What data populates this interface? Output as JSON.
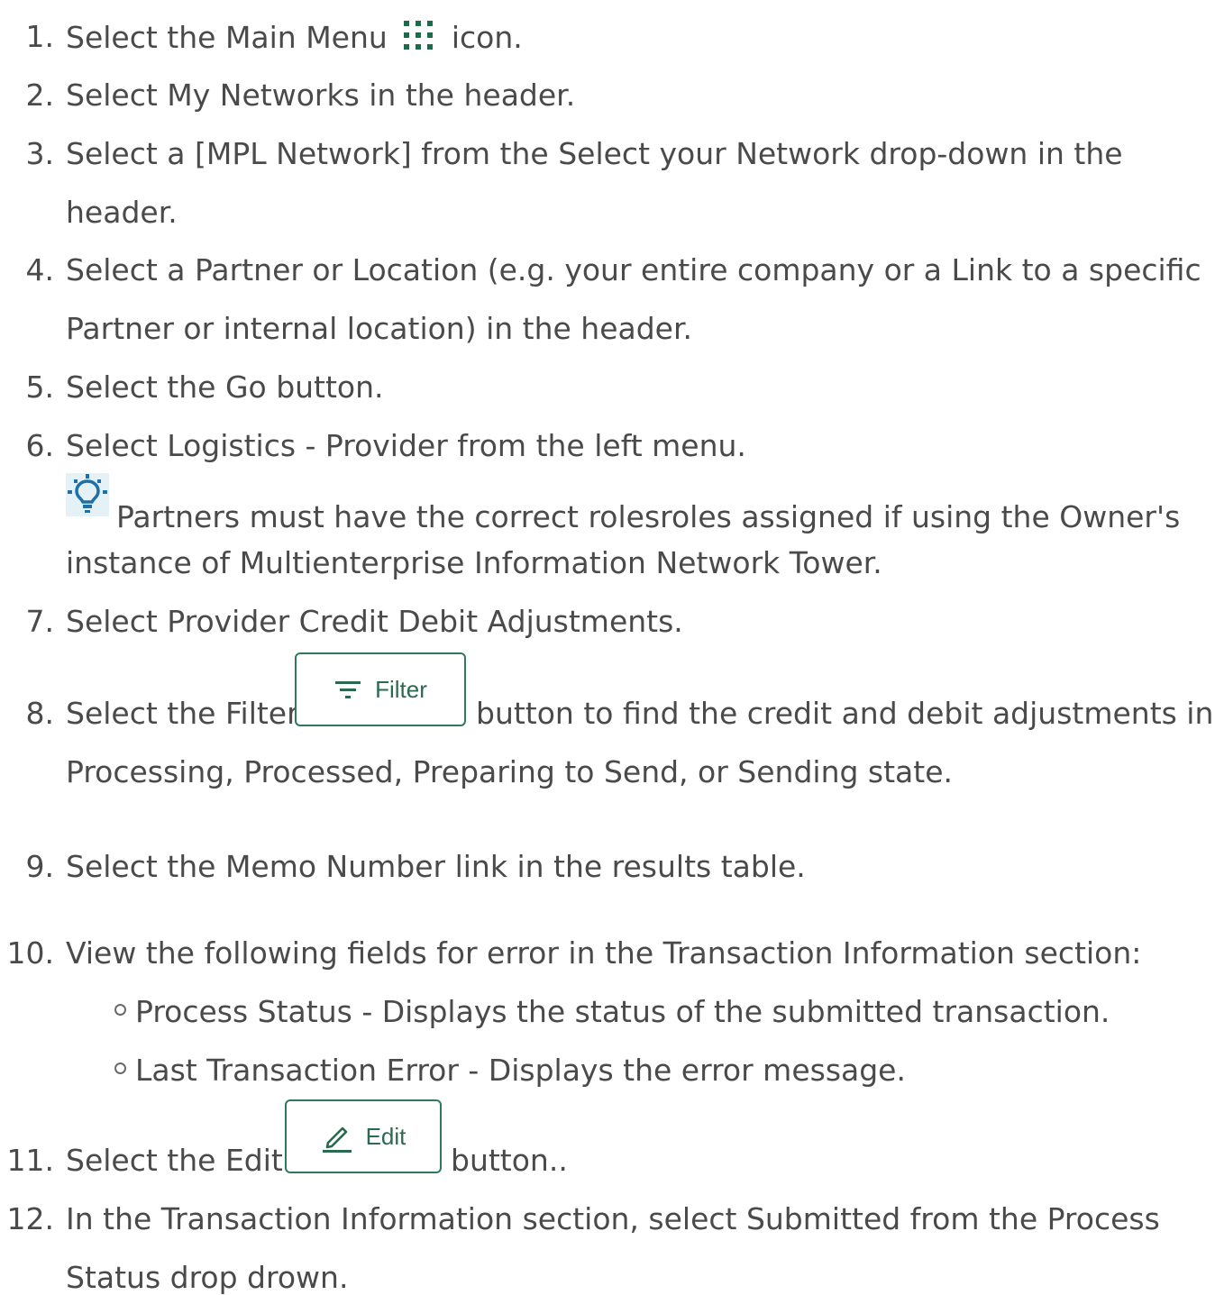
{
  "steps": [
    {
      "num": "1.",
      "before": "Select the Main Menu",
      "after": "icon.",
      "icon": "main-menu-grid-icon"
    },
    {
      "num": "2.",
      "text": "Select My Networks in the header."
    },
    {
      "num": "3.",
      "lines": [
        "Select a [MPL Network] from the Select your Network drop-down in the",
        "header."
      ]
    },
    {
      "num": "4.",
      "lines": [
        "Select a Partner or Location (e.g. your entire company or a Link to a specific",
        "Partner or internal location) in the header."
      ]
    },
    {
      "num": "5.",
      "text": "Select the Go button."
    },
    {
      "num": "6.",
      "text": " Select Logistics - Provider from the left menu.",
      "tip": {
        "icon": "lightbulb-icon",
        "lines": [
          "Partners must have the correct rolesroles assigned if using the Owner's",
          "instance of Multienterprise Information Network Tower."
        ]
      }
    },
    {
      "num": "7.",
      "text": "Select Provider Credit Debit Adjustments."
    },
    {
      "num": "8.",
      "before": "Select the Filter",
      "button": {
        "label": "Filter",
        "icon": "filter-icon"
      },
      "after": "button to find the credit and debit adjustments in",
      "line2": "Processing, Processed, Preparing to Send, or Sending state."
    },
    {
      "num": "9.",
      "text": "Select the Memo Number link in the results table."
    },
    {
      "num": "10.",
      "text": "View the following fields for error in the Transaction Information section:",
      "bullets": [
        "Process Status - Displays the status of the submitted transaction.",
        "Last Transaction Error - Displays the error message."
      ]
    },
    {
      "num": "11.",
      "before": "Select the Edit",
      "button": {
        "label": "Edit",
        "icon": "pencil-icon"
      },
      "after": "button.."
    },
    {
      "num": "12.",
      "lines": [
        "In the Transaction Information section, select Submitted from the Process",
        "Status drop drown."
      ]
    }
  ],
  "colors": {
    "text": "#4a4a4a",
    "button_border": "#2f7a5a",
    "button_text": "#2a6a50",
    "icon_green": "#1e6b4a",
    "tip_bg": "#e4f1f7",
    "tip_icon": "#1f6fa8"
  }
}
